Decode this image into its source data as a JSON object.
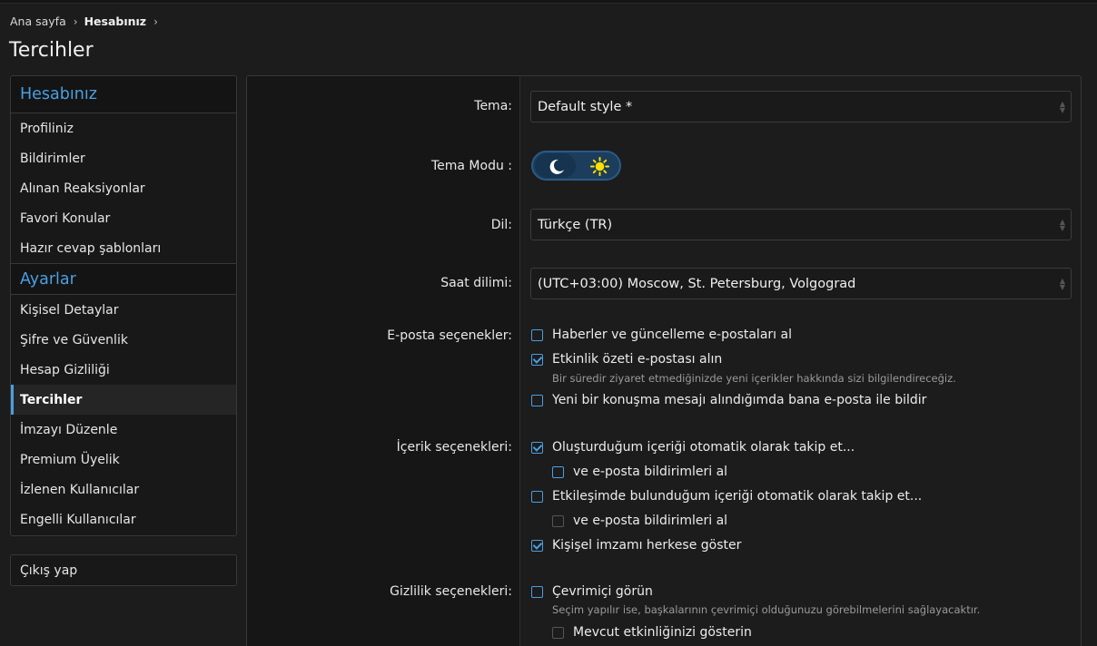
{
  "breadcrumb": {
    "home": "Ana sayfa",
    "current": "Hesabınız"
  },
  "page_title": "Tercihler",
  "sidebar": {
    "account_heading": "Hesabınız",
    "account_items": [
      {
        "label": "Profiliniz"
      },
      {
        "label": "Bildirimler"
      },
      {
        "label": "Alınan Reaksiyonlar"
      },
      {
        "label": "Favori Konular"
      },
      {
        "label": "Hazır cevap şablonları"
      }
    ],
    "settings_heading": "Ayarlar",
    "settings_items": [
      {
        "label": "Kişisel Detaylar"
      },
      {
        "label": "Şifre ve Güvenlik"
      },
      {
        "label": "Hesap Gizliliği"
      },
      {
        "label": "Tercihler",
        "active": true
      },
      {
        "label": "İmzayı Düzenle"
      },
      {
        "label": "Premium Üyelik"
      },
      {
        "label": "İzlenen Kullanıcılar"
      },
      {
        "label": "Engelli Kullanıcılar"
      }
    ],
    "logout": "Çıkış yap"
  },
  "form": {
    "theme_label": "Tema:",
    "theme_value": "Default style *",
    "theme_mode_label": "Tema Modu :",
    "theme_mode_value": "dark",
    "language_label": "Dil:",
    "language_value": "Türkçe (TR)",
    "timezone_label": "Saat dilimi:",
    "timezone_value": "(UTC+03:00) Moscow, St. Petersburg, Volgograd",
    "email_label": "E-posta seçenekler:",
    "email_options": {
      "news": {
        "label": "Haberler ve güncelleme e-postaları al",
        "checked": false
      },
      "digest": {
        "label": "Etkinlik özeti e-postası alın",
        "checked": true,
        "hint": "Bir süredir ziyaret etmediğinizde yeni içerikler hakkında sizi bilgilendireceğiz."
      },
      "conversation": {
        "label": "Yeni bir konuşma mesajı alındığımda bana e-posta ile bildir",
        "checked": false
      }
    },
    "content_label": "İçerik seçenekleri:",
    "content_options": {
      "watch_created": {
        "label": "Oluşturduğum içeriği otomatik olarak takip et...",
        "checked": true
      },
      "watch_created_email": {
        "label": "ve e-posta bildirimleri al",
        "checked": false
      },
      "watch_interacted": {
        "label": "Etkileşimde bulunduğum içeriği otomatik olarak takip et...",
        "checked": false
      },
      "watch_interacted_email": {
        "label": "ve e-posta bildirimleri al",
        "checked": false
      },
      "show_signature": {
        "label": "Kişişel imzamı herkese göster",
        "checked": true
      }
    },
    "privacy_label": "Gizlilik seçenekleri:",
    "privacy_options": {
      "online": {
        "label": "Çevrimiçi görün",
        "checked": false,
        "hint": "Seçim yapılır ise, başkalarının çevrimiçi olduğunuzu görebilmelerini sağlayacaktır."
      },
      "activity": {
        "label": "Mevcut etkinliğinizi gösterin",
        "checked": false
      }
    }
  },
  "colors": {
    "accent": "#4a9fe0",
    "background": "#1c1c1c",
    "panel": "#181818"
  },
  "icons": {
    "moon": "moon-icon",
    "sun": "sun-icon",
    "breadcrumb_sep": "chevron-right-icon"
  }
}
